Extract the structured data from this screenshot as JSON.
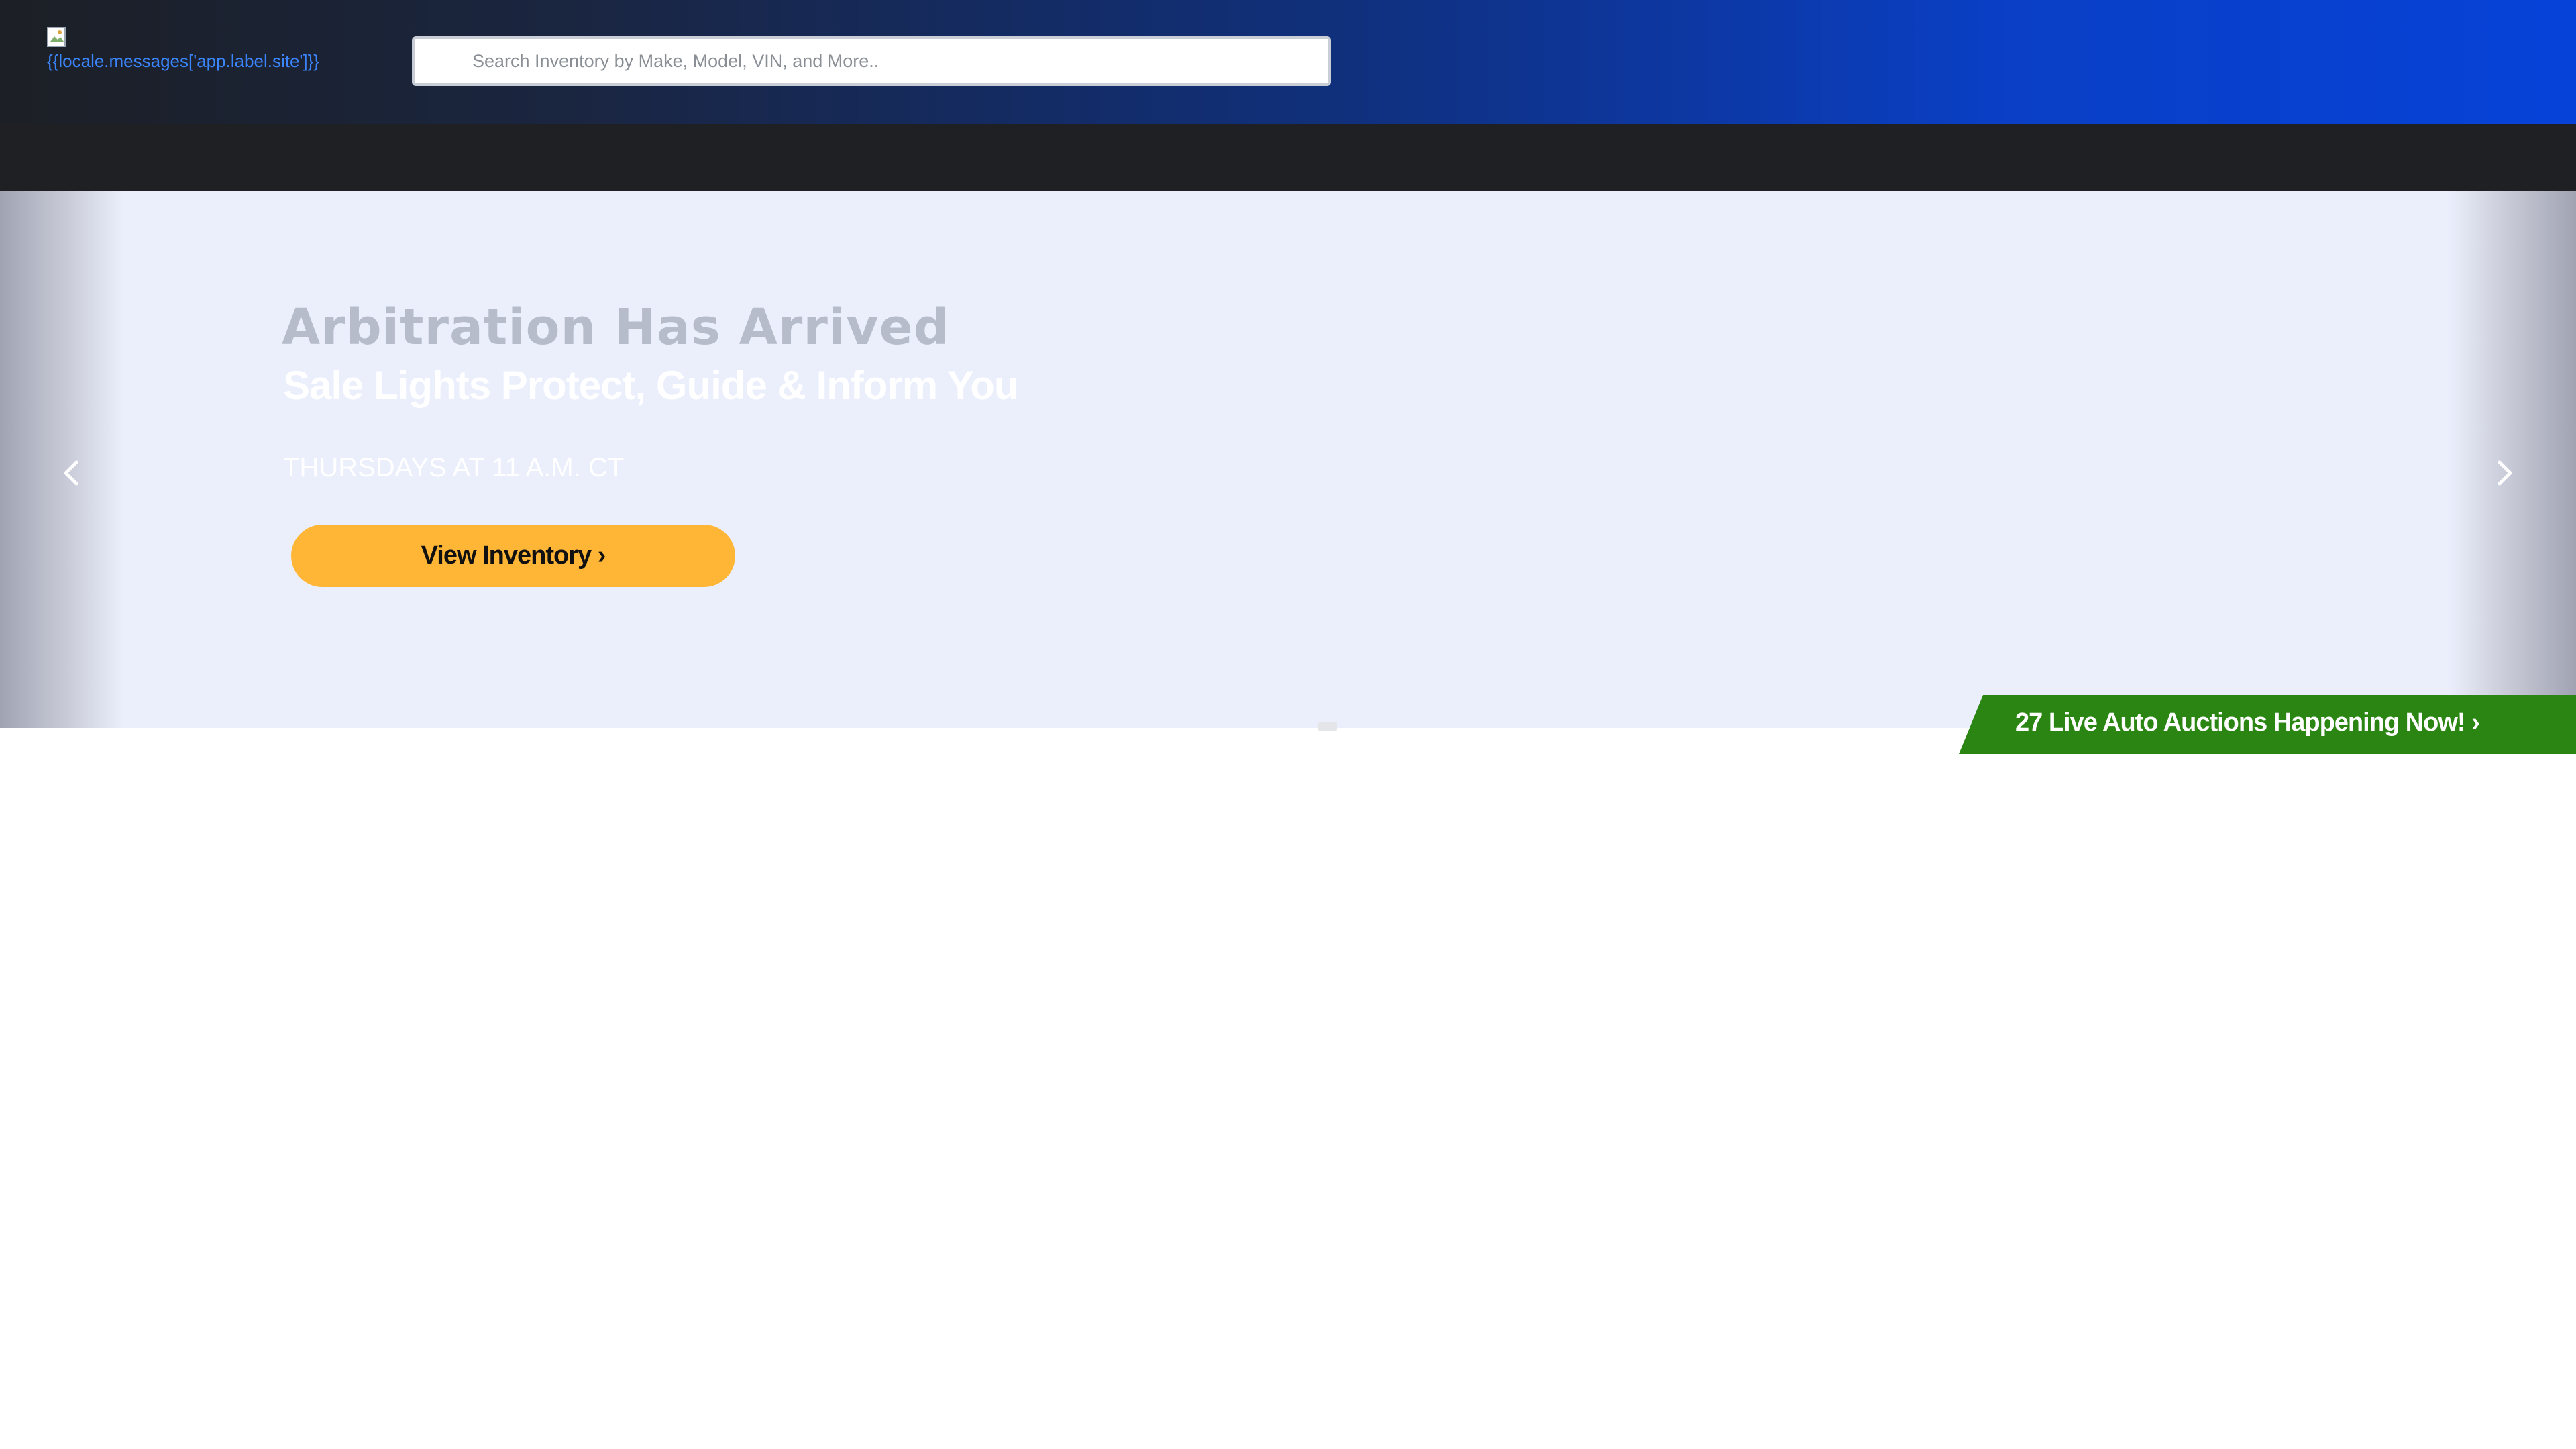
{
  "header": {
    "logo_alt_text": "{{locale.messages['app.label.site']}}",
    "search": {
      "placeholder": "Search Inventory by Make, Model, VIN, and More..",
      "value": ""
    }
  },
  "hero": {
    "title": "Arbitration Has Arrived",
    "subtitle": "Sale Lights Protect, Guide & Inform You",
    "schedule": "THURSDAYS AT 11 A.M. CT",
    "cta_label": "View Inventory ›",
    "cta_color": "#ffb637",
    "prev_icon": "chevron-left-icon",
    "next_icon": "chevron-right-icon"
  },
  "live_auctions": {
    "label": "27 Live Auto Auctions Happening Now! ›",
    "color": "#2a8512"
  }
}
